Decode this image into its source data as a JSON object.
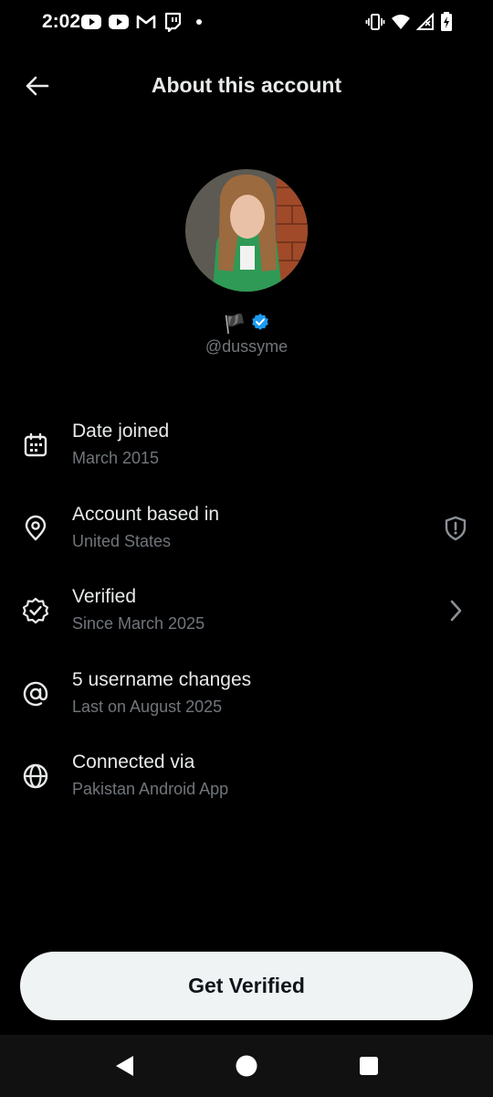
{
  "status_bar": {
    "time": "2:02",
    "left_icons": [
      "youtube-icon",
      "youtube-icon",
      "gmail-icon",
      "twitch-icon",
      "dot-icon"
    ],
    "right_icons": [
      "vibrate-icon",
      "wifi-icon",
      "signal-icon",
      "battery-charging-icon"
    ]
  },
  "header": {
    "title": "About this account",
    "back_icon": "arrow-left-icon"
  },
  "profile": {
    "flag_glyph": "🏴",
    "verified_badge_color": "#1d9bf0",
    "handle": "@dussyme"
  },
  "info_items": [
    {
      "icon": "calendar-icon",
      "title": "Date joined",
      "subtitle": "March 2015"
    },
    {
      "icon": "location-pin-icon",
      "title": "Account based in",
      "subtitle": "United States",
      "trailing_icon": "shield-alert-icon"
    },
    {
      "icon": "verified-check-icon",
      "title": "Verified",
      "subtitle": "Since March 2025",
      "trailing_icon": "chevron-right-icon"
    },
    {
      "icon": "at-sign-icon",
      "title": "5 username changes",
      "subtitle": "Last on August 2025"
    },
    {
      "icon": "globe-icon",
      "title": "Connected via",
      "subtitle": "Pakistan Android App"
    }
  ],
  "cta": {
    "label": "Get Verified"
  },
  "nav_bar": {
    "buttons": [
      "back-triangle-icon",
      "home-circle-icon",
      "recents-square-icon"
    ]
  },
  "colors": {
    "background": "#000000",
    "primary_text": "#e7e9ea",
    "secondary_text": "#71767b",
    "accent": "#1d9bf0",
    "cta_background": "#eff3f4"
  }
}
